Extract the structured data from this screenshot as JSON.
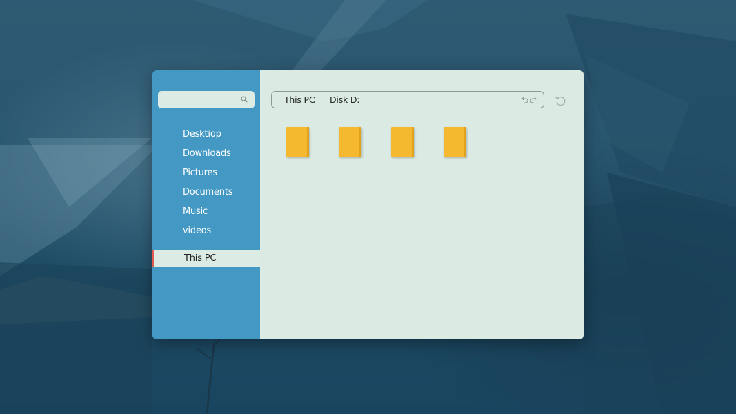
{
  "search": {
    "value": "",
    "placeholder": ""
  },
  "sidebar": {
    "items": [
      {
        "label": "Desktiop"
      },
      {
        "label": "Downloads"
      },
      {
        "label": "Pictures"
      },
      {
        "label": "Documents"
      },
      {
        "label": "Music"
      },
      {
        "label": "videos"
      }
    ],
    "active_item": "This PC"
  },
  "address_bar": {
    "crumb_root": "This PC",
    "separator": ":",
    "crumb_current": "Disk D:"
  },
  "files": [
    {
      "icon": "document-icon"
    },
    {
      "icon": "document-icon"
    },
    {
      "icon": "document-icon"
    },
    {
      "icon": "document-icon"
    }
  ],
  "colors": {
    "sidebar": "#4399c4",
    "content": "#dbebe4",
    "file": "#f4b92e",
    "active_marker": "#e25b4e"
  }
}
